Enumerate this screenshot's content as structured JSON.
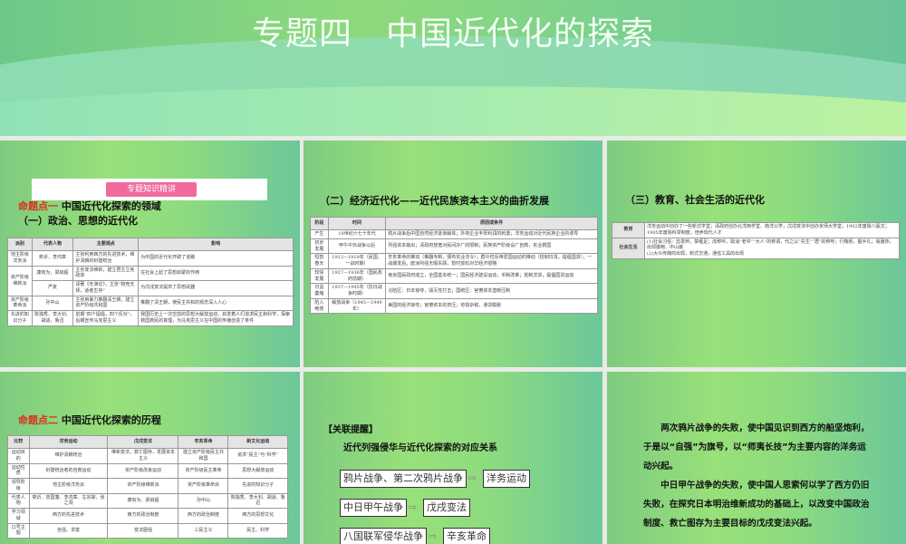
{
  "banner": {
    "title": "专题四　中国近代化的探索"
  },
  "slide1": {
    "badge": "专题知识精讲",
    "point_label": "命题点一",
    "point_title": "中国近代化探索的领域",
    "subtitle": "（一）政治、思想的近代化",
    "headers": [
      "派别",
      "代表人物",
      "主要观点",
      "影响"
    ],
    "rows": [
      [
        "地主阶级洋务派",
        "奕䜣、李鸿章",
        "主张利用西方的先进技术，维护清朝的封建统治",
        "为中国的近代化开辟了道路"
      ],
      [
        "资产阶级维新派",
        "康有为、梁启超",
        "主张变法维新，建立君主立宪政体",
        "在社会上起了思想启蒙的作用"
      ],
      [
        "",
        "严复",
        "译著《天演论》，主张“物竞天择，适者生存”",
        "为戊戌变法提供了思想武器"
      ],
      [
        "资产阶级革命派",
        "孙中山",
        "主张用暴力推翻清王朝，建立资产阶级共和国",
        "推翻了清王朝，使民主共和的观念深入人心"
      ],
      [
        "先进的知识分子",
        "陈独秀、李大钊、胡适、鲁迅",
        "前期“四个提倡，四个反对”，后期宣传马克思主义",
        "我国历史上一次空前的思想大解放运动，启发着人们追求民主和科学，探索救国救民的真理，为马克思主义在中国的传播创造了条件"
      ]
    ]
  },
  "slide2": {
    "title": "（二）经济近代化——近代民族资本主义的曲折发展",
    "headers": [
      "阶段",
      "时间",
      "原因或条件"
    ],
    "rows": [
      [
        "产生",
        "19世纪六七十年代",
        "鸦片战争后中国自然经济逐渐解体；外商企业丰厚利润的刺激；洋务运动对近代民族企业的诱导"
      ],
      [
        "初步发展",
        "甲午中日战争以后",
        "列强资本输出；清政府放宽对民间办厂的限制；民族资产阶级设厂自救，实业救国"
      ],
      [
        "短暂春天",
        "1912—1919年（民国、一战时期）",
        "辛亥革命的推动（推翻专制，颁布实业法令）；群众性反帝爱国运动的推动（抵制日货，提倡国货）；一战爆发后，欧洲列强无暇东顾，暂时放松对华经济侵略"
      ],
      [
        "较快发展",
        "1927—1936年（国民政府前期）",
        "南京国民政府成立，全国基本统一；国民经济建设运动，币制改革；抵制洋货，提倡国货运动"
      ],
      [
        "日益萎缩",
        "1937—1945年（抗日战争时期）",
        "沦陷区：日本掠夺，毁灭性打击；国统区：官僚资本垄断压制"
      ],
      [
        "陷入绝境",
        "解放战争（1945—1949年）",
        "美国的经济掠夺；官僚资本的挤压；苛捐杂税，通货膨胀"
      ]
    ]
  },
  "slide3": {
    "title": "（三）教育、社会生活的近代化",
    "rows": [
      [
        "教育",
        "洋务运动中创办了一些新式学堂；清政府创办北洋西学堂、南洋公学；戊戌变法中创办京师大学堂；1902年废除八股文；1905年废除科举制度，培养现代人才"
      ],
      [
        "社会生活",
        "(1)社会习俗：剪发辫，禁缠足；改称呼，取消“老爷”“大人”的称谓，代之以“先生”“君”的称呼；行鞠躬，握手礼；易服饰，出现旗袍、中山装\n(2)大众传媒的出现，新式交通，通信工具的出现"
      ]
    ]
  },
  "slide4": {
    "point_label": "命题点二",
    "point_title": "中国近代化探索的历程",
    "headers": [
      "比较",
      "洋务运动",
      "戊戌变法",
      "辛亥革命",
      "新文化运动"
    ],
    "rows": [
      [
        "运动目的",
        "维护清朝统治",
        "维新变法，救亡图存，发展资本主义",
        "建立资产阶级民主共和国",
        "追求“民主”与“科学”"
      ],
      [
        "运动性质",
        "封建统治者的自救运动",
        "资产阶级改良运动",
        "资产阶级民主革命",
        "思想大解放运动"
      ],
      [
        "领导阶级",
        "地主阶级洋务派",
        "资产阶级维新派",
        "资产阶级革命派",
        "先进的知识分子"
      ],
      [
        "代表人物",
        "奕䜣、曾国藩、李鸿章、左宗棠、张之洞",
        "康有为、梁启超",
        "孙中山",
        "陈独秀、李大钊、胡适、鲁迅"
      ],
      [
        "学习领域",
        "西方的先进技术",
        "西方的政治制度",
        "西方的政治制度",
        "西方的思想文化"
      ],
      [
        "口号主题",
        "自强、求富",
        "变法图强",
        "三民主义",
        "民主、科学"
      ]
    ]
  },
  "slide5": {
    "label": "【关联提醒】",
    "subtitle": "近代列强侵华与近代化探索的对应关系",
    "pairs": [
      {
        "cause": "鸦片战争、第二次鸦片战争",
        "result": "洋务运动"
      },
      {
        "cause": "中日甲午战争",
        "result": "戊戌变法"
      },
      {
        "cause": "八国联军侵华战争",
        "result": "辛亥革命"
      }
    ],
    "arrow": "⇨"
  },
  "slide6": {
    "paragraphs": [
      "两次鸦片战争的失败，使中国见识到西方的船坚炮利，于是以“自强”为旗号，以“师夷长技”为主要内容的洋务运动兴起。",
      "中日甲午战争的失败，使中国人思索何以学了西方仍旧失败，在探究日本明治维新成功的基础上，以改变中国政治制度、救亡图存为主要目标的戊戌变法兴起。"
    ]
  }
}
